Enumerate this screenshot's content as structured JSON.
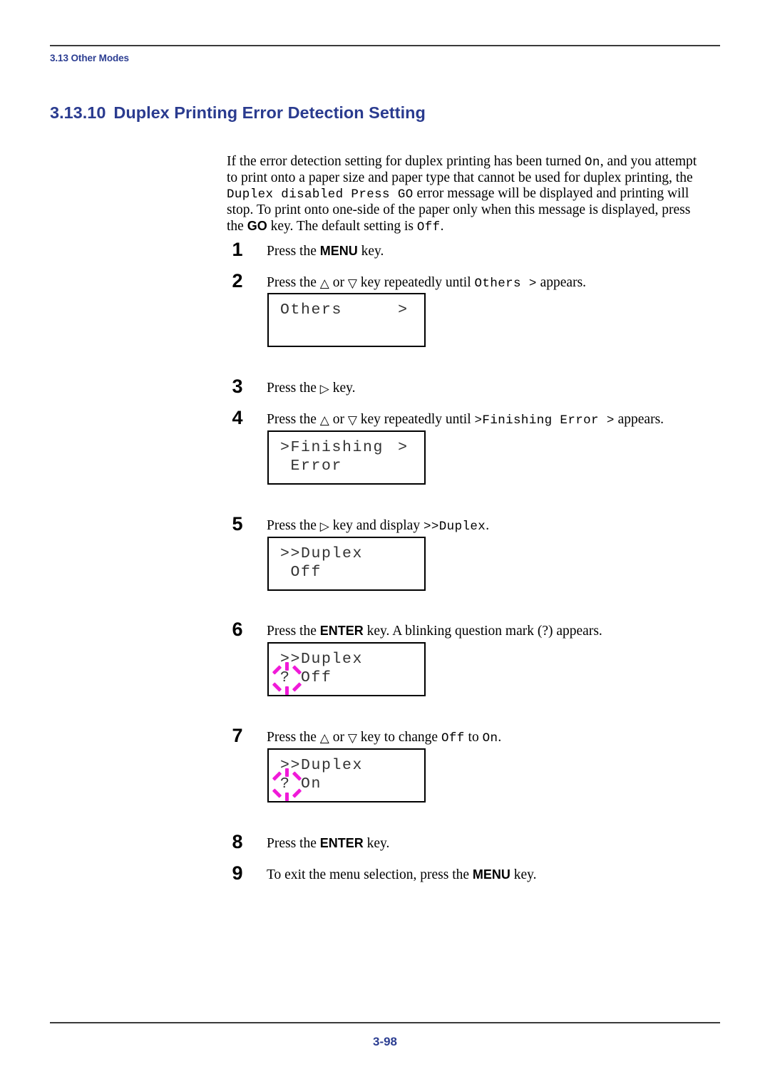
{
  "header": {
    "running_head": "3.13 Other Modes"
  },
  "section": {
    "number": "3.13.10",
    "title": "Duplex Printing Error Detection Setting"
  },
  "intro": {
    "t1": "If the error detection setting for duplex printing has been turned ",
    "m1": "On",
    "t2": ", and you attempt to print onto a paper size and paper type that cannot be used for duplex printing, the ",
    "m2": "Duplex disabled Press GO",
    "t3": " error message will be displayed and printing will stop. To print onto one-side of the paper only when this message is displayed, press the ",
    "k1": "GO",
    "t4": " key. The default setting is ",
    "m3": "Off",
    "t5": "."
  },
  "steps": [
    {
      "number": "1",
      "parts": [
        {
          "kind": "text",
          "value": "Press the "
        },
        {
          "kind": "key",
          "value": "MENU"
        },
        {
          "kind": "text",
          "value": " key."
        }
      ]
    },
    {
      "number": "2",
      "parts": [
        {
          "kind": "text",
          "value": "Press the "
        },
        {
          "kind": "glyph",
          "value": "△"
        },
        {
          "kind": "text",
          "value": " or "
        },
        {
          "kind": "glyph",
          "value": "▽"
        },
        {
          "kind": "text",
          "value": " key repeatedly until "
        },
        {
          "kind": "mono",
          "value": "Others >"
        },
        {
          "kind": "text",
          "value": " appears."
        }
      ]
    },
    {
      "number": "3",
      "parts": [
        {
          "kind": "text",
          "value": "Press the "
        },
        {
          "kind": "glyph",
          "value": "▷"
        },
        {
          "kind": "text",
          "value": " key."
        }
      ]
    },
    {
      "number": "4",
      "parts": [
        {
          "kind": "text",
          "value": "Press the "
        },
        {
          "kind": "glyph",
          "value": "△"
        },
        {
          "kind": "text",
          "value": " or "
        },
        {
          "kind": "glyph",
          "value": "▽"
        },
        {
          "kind": "text",
          "value": " key repeatedly until "
        },
        {
          "kind": "mono",
          "value": ">Finishing Error >"
        },
        {
          "kind": "text",
          "value": " appears."
        }
      ]
    },
    {
      "number": "5",
      "parts": [
        {
          "kind": "text",
          "value": "Press the "
        },
        {
          "kind": "glyph",
          "value": "▷"
        },
        {
          "kind": "text",
          "value": " key and display "
        },
        {
          "kind": "mono",
          "value": ">>Duplex"
        },
        {
          "kind": "text",
          "value": "."
        }
      ]
    },
    {
      "number": "6",
      "parts": [
        {
          "kind": "text",
          "value": "Press the "
        },
        {
          "kind": "key",
          "value": "ENTER"
        },
        {
          "kind": "text",
          "value": " key. A blinking question mark (?) appears."
        }
      ]
    },
    {
      "number": "7",
      "parts": [
        {
          "kind": "text",
          "value": "Press the "
        },
        {
          "kind": "glyph",
          "value": "△"
        },
        {
          "kind": "text",
          "value": " or "
        },
        {
          "kind": "glyph",
          "value": "▽"
        },
        {
          "kind": "text",
          "value": " key to change "
        },
        {
          "kind": "mono",
          "value": "Off"
        },
        {
          "kind": "text",
          "value": " to "
        },
        {
          "kind": "mono",
          "value": "On"
        },
        {
          "kind": "text",
          "value": "."
        }
      ]
    },
    {
      "number": "8",
      "parts": [
        {
          "kind": "text",
          "value": "Press the "
        },
        {
          "kind": "key",
          "value": "ENTER"
        },
        {
          "kind": "text",
          "value": " key."
        }
      ]
    },
    {
      "number": "9",
      "parts": [
        {
          "kind": "text",
          "value": "To exit the menu selection, press the "
        },
        {
          "kind": "key",
          "value": "MENU"
        },
        {
          "kind": "text",
          "value": " key."
        }
      ]
    }
  ],
  "displays": [
    {
      "id": "others",
      "line1": "Others",
      "line2": "",
      "caret": ">",
      "blink": false
    },
    {
      "id": "finishing",
      "line1": ">Finishing",
      "line2": " Error",
      "caret": ">",
      "blink": false
    },
    {
      "id": "duplex-off",
      "line1": ">>Duplex",
      "line2": " Off",
      "caret": "",
      "blink": false
    },
    {
      "id": "duplex-off-q",
      "line1": ">>Duplex",
      "line2": "? Off",
      "caret": "",
      "blink": true
    },
    {
      "id": "duplex-on-q",
      "line1": ">>Duplex",
      "line2": "? On",
      "caret": "",
      "blink": true
    }
  ],
  "footer": {
    "page_number": "3-98"
  },
  "colors": {
    "heading_blue": "#2a3b8f",
    "blink_magenta": "#f01ad8",
    "rule_gray": "#3a3a3a"
  }
}
